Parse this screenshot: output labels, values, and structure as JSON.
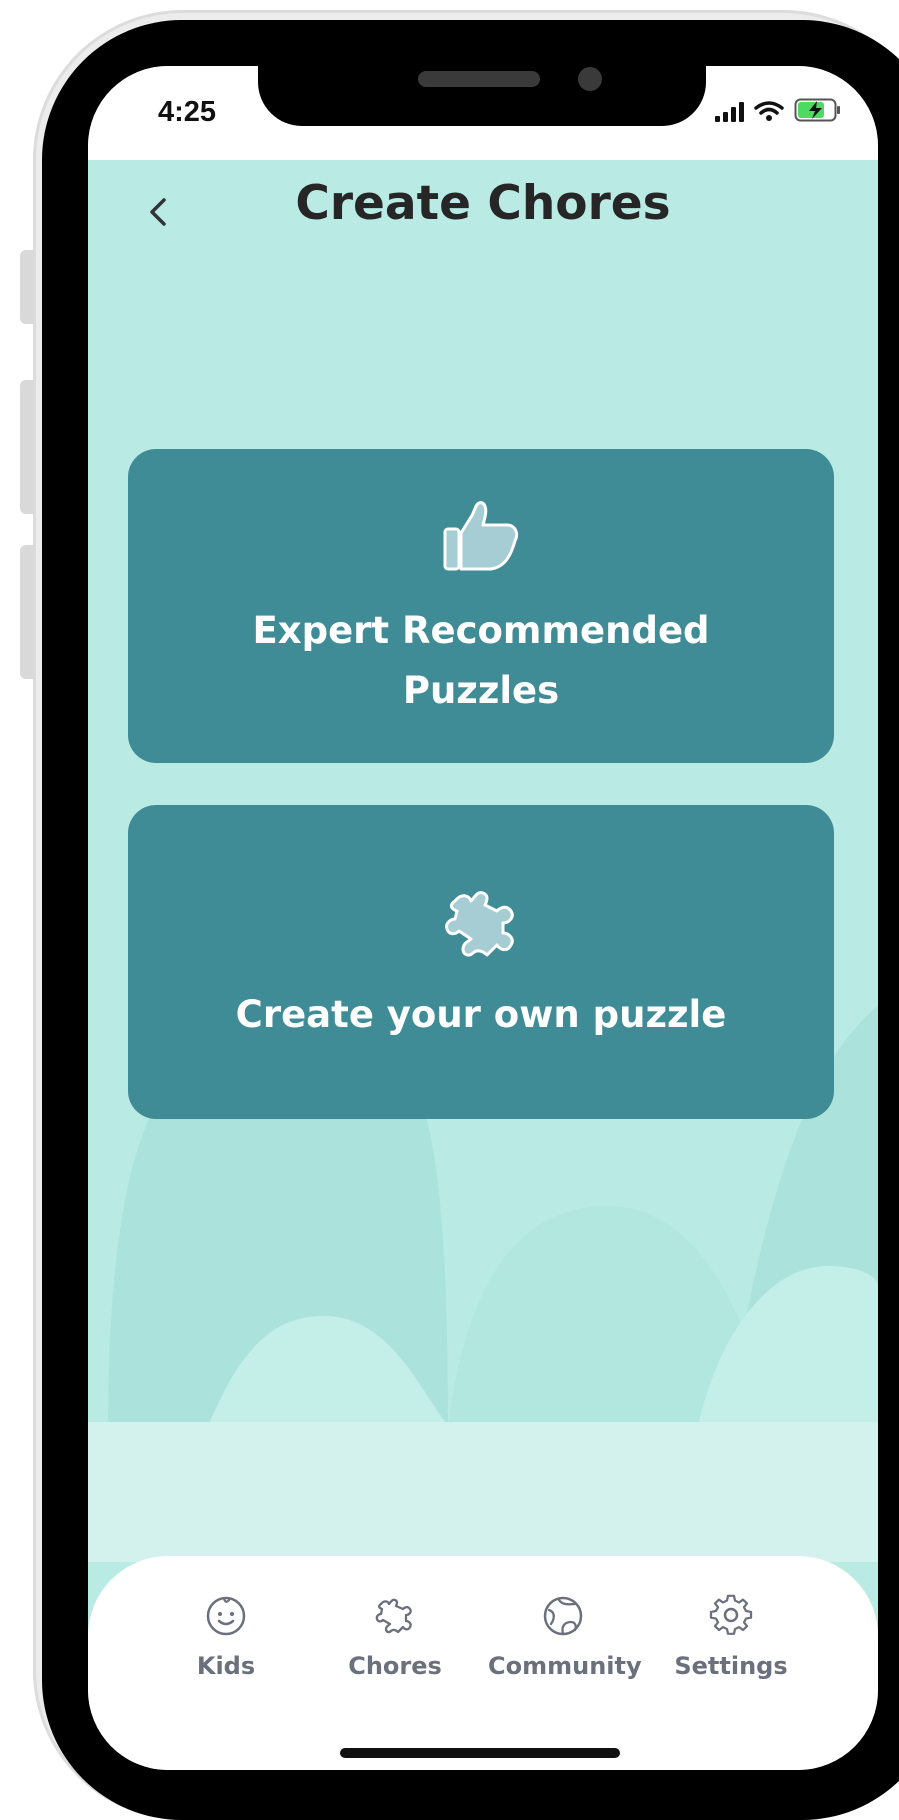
{
  "status_bar": {
    "time": "4:25"
  },
  "header": {
    "title": "Create Chores",
    "back_icon": "chevron-left-icon"
  },
  "cards": [
    {
      "label_line1": "Expert Recommended",
      "label_line2": "Puzzles",
      "icon": "thumbs-up-icon"
    },
    {
      "label": "Create your own puzzle",
      "icon": "puzzle-piece-icon"
    }
  ],
  "bottom_nav": {
    "items": [
      {
        "label": "Kids",
        "icon": "smiley-face-icon"
      },
      {
        "label": "Chores",
        "icon": "puzzle-piece-icon"
      },
      {
        "label": "Community",
        "icon": "globe-icon"
      },
      {
        "label": "Settings",
        "icon": "gear-icon"
      }
    ]
  },
  "colors": {
    "background": "#b9ebe4",
    "card": "#3f8c96",
    "nav_label": "#6a707c"
  }
}
